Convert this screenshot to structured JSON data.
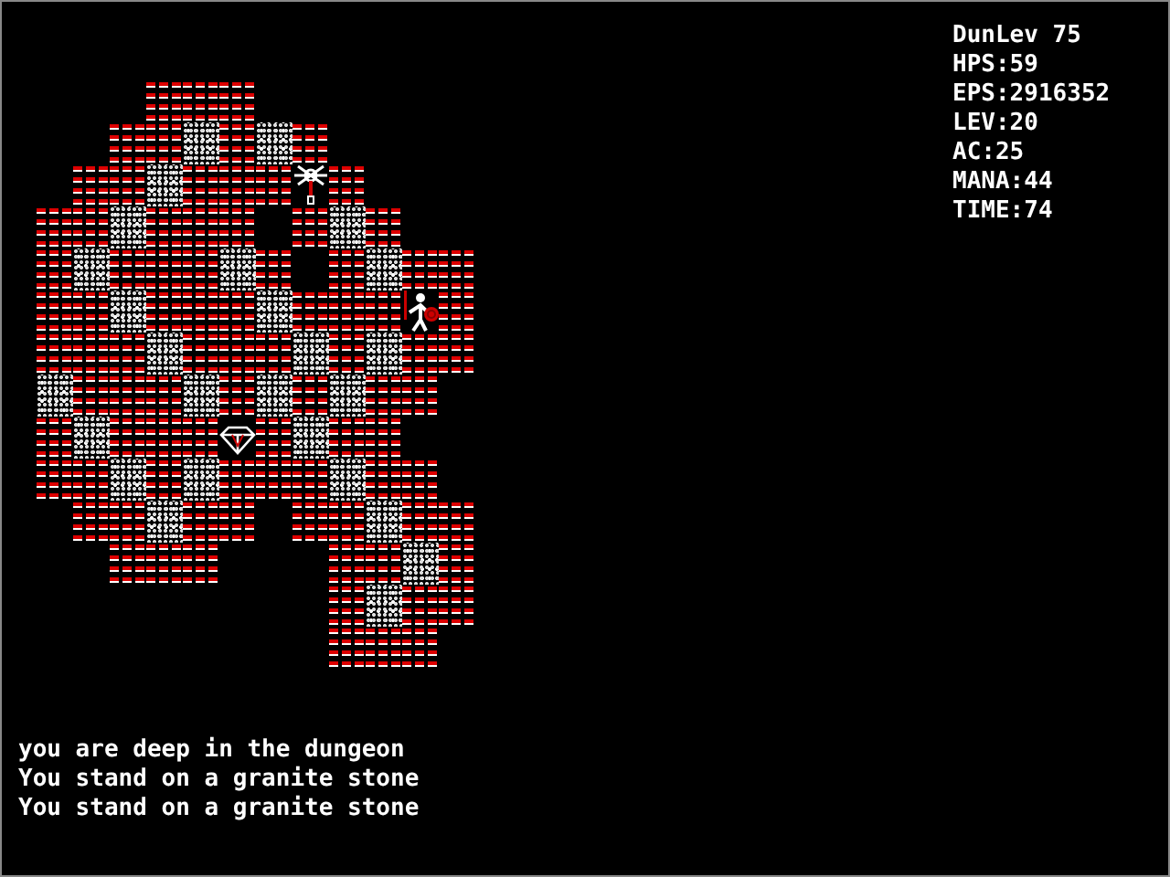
{
  "map": {
    "rows": [
      {
        "tiles": [
          {
            "kind": "void"
          },
          {
            "kind": "void"
          },
          {
            "kind": "void"
          },
          {
            "kind": "brick"
          },
          {
            "kind": "brick"
          },
          {
            "kind": "brick"
          },
          {
            "kind": "void"
          },
          {
            "kind": "void"
          },
          {
            "kind": "void"
          },
          {
            "kind": "void"
          },
          {
            "kind": "void"
          },
          {
            "kind": "void"
          }
        ]
      },
      {
        "tiles": [
          {
            "kind": "void"
          },
          {
            "kind": "void"
          },
          {
            "kind": "brick"
          },
          {
            "kind": "brick"
          },
          {
            "kind": "granite"
          },
          {
            "kind": "brick"
          },
          {
            "kind": "granite"
          },
          {
            "kind": "brick"
          },
          {
            "kind": "void"
          },
          {
            "kind": "void"
          },
          {
            "kind": "void"
          },
          {
            "kind": "void"
          }
        ]
      },
      {
        "tiles": [
          {
            "kind": "void"
          },
          {
            "kind": "brick"
          },
          {
            "kind": "brick"
          },
          {
            "kind": "granite"
          },
          {
            "kind": "brick"
          },
          {
            "kind": "brick"
          },
          {
            "kind": "brick"
          },
          {
            "kind": "wand"
          },
          {
            "kind": "brick"
          },
          {
            "kind": "void"
          },
          {
            "kind": "void"
          },
          {
            "kind": "void"
          }
        ]
      },
      {
        "tiles": [
          {
            "kind": "brick"
          },
          {
            "kind": "brick"
          },
          {
            "kind": "granite"
          },
          {
            "kind": "brick"
          },
          {
            "kind": "brick"
          },
          {
            "kind": "brick"
          },
          {
            "kind": "void"
          },
          {
            "kind": "brick"
          },
          {
            "kind": "granite"
          },
          {
            "kind": "brick"
          },
          {
            "kind": "void"
          },
          {
            "kind": "void"
          }
        ]
      },
      {
        "tiles": [
          {
            "kind": "brick"
          },
          {
            "kind": "granite"
          },
          {
            "kind": "brick"
          },
          {
            "kind": "brick"
          },
          {
            "kind": "brick"
          },
          {
            "kind": "granite"
          },
          {
            "kind": "brick"
          },
          {
            "kind": "void"
          },
          {
            "kind": "brick"
          },
          {
            "kind": "granite"
          },
          {
            "kind": "brick"
          },
          {
            "kind": "brick"
          }
        ]
      },
      {
        "tiles": [
          {
            "kind": "brick"
          },
          {
            "kind": "brick"
          },
          {
            "kind": "granite"
          },
          {
            "kind": "brick"
          },
          {
            "kind": "brick"
          },
          {
            "kind": "brick"
          },
          {
            "kind": "granite"
          },
          {
            "kind": "brick"
          },
          {
            "kind": "brick"
          },
          {
            "kind": "brick"
          },
          {
            "kind": "player"
          },
          {
            "kind": "brick"
          }
        ]
      },
      {
        "tiles": [
          {
            "kind": "brick"
          },
          {
            "kind": "brick"
          },
          {
            "kind": "brick"
          },
          {
            "kind": "granite"
          },
          {
            "kind": "brick"
          },
          {
            "kind": "brick"
          },
          {
            "kind": "brick"
          },
          {
            "kind": "granite"
          },
          {
            "kind": "brick"
          },
          {
            "kind": "granite"
          },
          {
            "kind": "brick"
          },
          {
            "kind": "brick"
          }
        ]
      },
      {
        "tiles": [
          {
            "kind": "granite"
          },
          {
            "kind": "brick"
          },
          {
            "kind": "brick"
          },
          {
            "kind": "brick"
          },
          {
            "kind": "granite"
          },
          {
            "kind": "brick"
          },
          {
            "kind": "granite"
          },
          {
            "kind": "brick"
          },
          {
            "kind": "granite"
          },
          {
            "kind": "brick"
          },
          {
            "kind": "brick"
          },
          {
            "kind": "void"
          }
        ]
      },
      {
        "tiles": [
          {
            "kind": "brick"
          },
          {
            "kind": "granite"
          },
          {
            "kind": "brick"
          },
          {
            "kind": "brick"
          },
          {
            "kind": "brick"
          },
          {
            "kind": "gem"
          },
          {
            "kind": "brick"
          },
          {
            "kind": "granite"
          },
          {
            "kind": "brick"
          },
          {
            "kind": "brick"
          },
          {
            "kind": "void"
          },
          {
            "kind": "void"
          }
        ]
      },
      {
        "tiles": [
          {
            "kind": "brick"
          },
          {
            "kind": "brick"
          },
          {
            "kind": "granite"
          },
          {
            "kind": "brick"
          },
          {
            "kind": "granite"
          },
          {
            "kind": "brick"
          },
          {
            "kind": "brick"
          },
          {
            "kind": "brick"
          },
          {
            "kind": "granite"
          },
          {
            "kind": "brick"
          },
          {
            "kind": "brick"
          },
          {
            "kind": "void"
          }
        ]
      },
      {
        "tiles": [
          {
            "kind": "void"
          },
          {
            "kind": "brick"
          },
          {
            "kind": "brick"
          },
          {
            "kind": "granite"
          },
          {
            "kind": "brick"
          },
          {
            "kind": "brick"
          },
          {
            "kind": "void"
          },
          {
            "kind": "brick"
          },
          {
            "kind": "brick"
          },
          {
            "kind": "granite"
          },
          {
            "kind": "brick"
          },
          {
            "kind": "brick"
          }
        ]
      },
      {
        "tiles": [
          {
            "kind": "void"
          },
          {
            "kind": "void"
          },
          {
            "kind": "brick"
          },
          {
            "kind": "brick"
          },
          {
            "kind": "brick"
          },
          {
            "kind": "void"
          },
          {
            "kind": "void"
          },
          {
            "kind": "void"
          },
          {
            "kind": "brick"
          },
          {
            "kind": "brick"
          },
          {
            "kind": "granite"
          },
          {
            "kind": "brick"
          }
        ]
      },
      {
        "tiles": [
          {
            "kind": "void"
          },
          {
            "kind": "void"
          },
          {
            "kind": "void"
          },
          {
            "kind": "void"
          },
          {
            "kind": "void"
          },
          {
            "kind": "void"
          },
          {
            "kind": "void"
          },
          {
            "kind": "void"
          },
          {
            "kind": "brick"
          },
          {
            "kind": "granite"
          },
          {
            "kind": "brick"
          },
          {
            "kind": "brick"
          }
        ]
      },
      {
        "tiles": [
          {
            "kind": "void"
          },
          {
            "kind": "void"
          },
          {
            "kind": "void"
          },
          {
            "kind": "void"
          },
          {
            "kind": "void"
          },
          {
            "kind": "void"
          },
          {
            "kind": "void"
          },
          {
            "kind": "void"
          },
          {
            "kind": "brick"
          },
          {
            "kind": "brick"
          },
          {
            "kind": "brick"
          },
          {
            "kind": "void"
          }
        ]
      }
    ]
  },
  "stats": [
    "DunLev 75",
    "HPS:59",
    "EPS:2916352",
    "LEV:20",
    "AC:25",
    "MANA:44",
    "TIME:74"
  ],
  "messages": [
    "you are deep in the dungeon",
    "You stand on a granite stone",
    "You stand on a granite stone"
  ]
}
